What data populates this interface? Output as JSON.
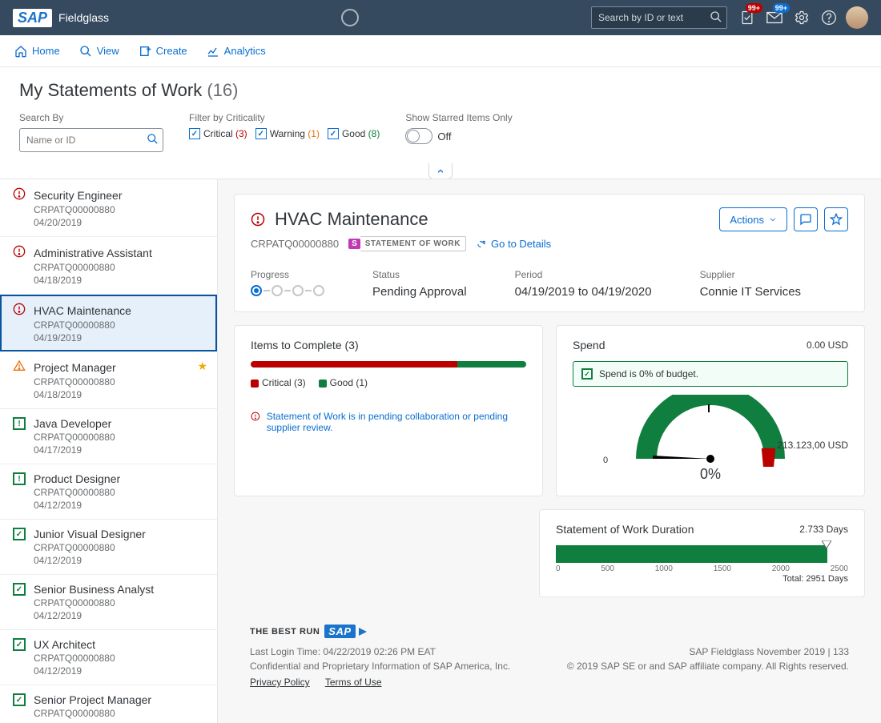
{
  "header": {
    "app_name": "Fieldglass",
    "search_placeholder": "Search by ID or text",
    "badge_approvals": "99+",
    "badge_messages": "99+"
  },
  "nav": {
    "home": "Home",
    "view": "View",
    "create": "Create",
    "analytics": "Analytics"
  },
  "page": {
    "title": "My Statements of Work",
    "count": "(16)",
    "search_by_label": "Search By",
    "search_placeholder": "Name or ID",
    "filter_label": "Filter by Criticality",
    "critical_label": "Critical",
    "critical_count": "(3)",
    "warning_label": "Warning",
    "warning_count": "(1)",
    "good_label": "Good",
    "good_count": "(8)",
    "starred_label": "Show Starred Items Only",
    "toggle_off": "Off"
  },
  "list": [
    {
      "status": "critical",
      "title": "Security Engineer",
      "id": "CRPATQ00000880",
      "date": "04/20/2019"
    },
    {
      "status": "critical",
      "title": "Administrative Assistant",
      "id": "CRPATQ00000880",
      "date": "04/18/2019"
    },
    {
      "status": "critical",
      "title": "HVAC Maintenance",
      "id": "CRPATQ00000880",
      "date": "04/19/2019",
      "selected": true
    },
    {
      "status": "warning",
      "title": "Project Manager",
      "id": "CRPATQ00000880",
      "date": "04/18/2019",
      "starred": true
    },
    {
      "status": "good-sq",
      "title": "Java Developer",
      "id": "CRPATQ00000880",
      "date": "04/17/2019"
    },
    {
      "status": "good-sq",
      "title": "Product Designer",
      "id": "CRPATQ00000880",
      "date": "04/12/2019"
    },
    {
      "status": "good",
      "title": "Junior Visual Designer",
      "id": "CRPATQ00000880",
      "date": "04/12/2019"
    },
    {
      "status": "good",
      "title": "Senior Business Analyst",
      "id": "CRPATQ00000880",
      "date": "04/12/2019"
    },
    {
      "status": "good",
      "title": "UX Architect",
      "id": "CRPATQ00000880",
      "date": "04/12/2019"
    },
    {
      "status": "good",
      "title": "Senior Project Manager",
      "id": "CRPATQ00000880",
      "date": ""
    }
  ],
  "detail": {
    "title": "HVAC Maintenance",
    "id": "CRPATQ00000880",
    "tag_short": "S",
    "tag_label": "STATEMENT OF WORK",
    "go_to_details": "Go to Details",
    "actions_btn": "Actions",
    "progress_label": "Progress",
    "status_label": "Status",
    "status_value": "Pending Approval",
    "period_label": "Period",
    "period_value": "04/19/2019 to 04/19/2020",
    "supplier_label": "Supplier",
    "supplier_value": "Connie IT Services",
    "items_title": "Items to Complete (3)",
    "legend_crit": "Critical (3)",
    "legend_good": "Good (1)",
    "pending_msg": "Statement of Work is in pending collaboration or pending supplier review.",
    "spend_title": "Spend",
    "spend_value": "0.00 USD",
    "spend_info": "Spend is 0% of budget.",
    "gauge_max": "213.123,00 USD",
    "gauge_pct": "0%",
    "gauge_zero": "0",
    "duration_title": "Statement of Work Duration",
    "duration_value": "2.733 Days",
    "duration_total": "Total: 2951 Days",
    "axis": [
      "0",
      "500",
      "1000",
      "1500",
      "2000",
      "2500"
    ]
  },
  "footer": {
    "brand": "THE BEST RUN",
    "last_login": "Last Login Time: 04/22/2019 02:26 PM EAT",
    "confidential": "Confidential and Proprietary Information of SAP America, Inc.",
    "privacy": "Privacy Policy",
    "terms": "Terms of Use",
    "version": "SAP Fieldglass November 2019 | 133",
    "copyright": "© 2019 SAP SE or and SAP affiliate company. All Rights reserved."
  },
  "chart_data": [
    {
      "type": "bar",
      "title": "Items to Complete (3)",
      "categories": [
        "Critical",
        "Good"
      ],
      "values": [
        3,
        1
      ]
    },
    {
      "type": "gauge",
      "title": "Spend",
      "value": 0,
      "max": 213123.0,
      "unit": "USD",
      "percent": 0
    },
    {
      "type": "bar",
      "title": "Statement of Work Duration",
      "x": [
        0,
        500,
        1000,
        1500,
        2000,
        2500
      ],
      "values": [
        2733
      ],
      "total": 2951,
      "unit": "Days"
    }
  ]
}
